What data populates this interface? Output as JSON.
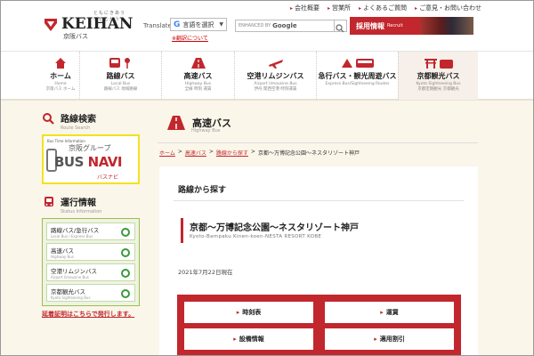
{
  "header": {
    "logo": {
      "tagline": "ともにきあう ひとむかう",
      "brand": "KEIHAN",
      "sub": "京阪バス"
    },
    "top_links": [
      "会社概要",
      "営業所",
      "よくあるご質問",
      "ご意見・お問い合わせ"
    ],
    "translate": {
      "label": "Translate",
      "select_value": "言語を選択",
      "note": "※翻訳について"
    },
    "search": {
      "placeholder_small": "ENHANCED BY",
      "placeholder_brand": "Google"
    },
    "recruit": {
      "label": "採用情報",
      "sub": "Recruit"
    }
  },
  "nav": [
    {
      "label": "ホーム",
      "sub": "Home\n京阪バス ホーム"
    },
    {
      "label": "路線バス",
      "sub": "Local Bus\n路線バス 地域路線"
    },
    {
      "label": "高速バス",
      "sub": "Highway Bus\n全線 時刻 運賃"
    },
    {
      "label": "空港リムジンバス",
      "sub": "Airport limousine Bus\n伊丹 関西空港 時刻運賃"
    },
    {
      "label": "急行バス・観光周遊バス",
      "sub": "Express Bus/Sightseeing Routes"
    },
    {
      "label": "京都観光バス",
      "sub": "Kyoto Sightseeing Bus\n京都定期観光 京都観光"
    }
  ],
  "sidebar": {
    "route_search": {
      "title": "路線検索",
      "sub": "Route Search"
    },
    "busnavi": {
      "small": "Bus Time Information",
      "group": "京阪グループ",
      "bus": "BUS",
      "navi": "NAVI",
      "kana": "バスナビ"
    },
    "status": {
      "title": "運行情報",
      "sub": "Status Information",
      "items": [
        {
          "label": "路線バス/急行バス",
          "sub": "Local Bus / Express Bus"
        },
        {
          "label": "高速バス",
          "sub": "Highway Bus"
        },
        {
          "label": "空港リムジンバス",
          "sub": "Airport limousine Bus"
        },
        {
          "label": "京都観光バス",
          "sub": "Kyoto Sightseeing Bus"
        }
      ]
    },
    "delay_link": "延着証明はこちらで発行します。"
  },
  "main": {
    "title": "高速バス",
    "title_en": "Highway Bus",
    "breadcrumb": [
      "ホーム",
      "高速バス",
      "路線から探す",
      "京都〜万博記念公園〜ネスタリゾート神戸"
    ],
    "panel_heading": "路線から探す",
    "route_jp": "京都〜万博記念公園〜ネスタリゾート神戸",
    "route_en": "Kyoto-Bampaku Kinen-koen-NESTA RESORT KOBE",
    "date": "2021年7月22日現在",
    "buttons": [
      "時刻表",
      "運賃",
      "設備情報",
      "適用割引"
    ]
  },
  "colors": {
    "accent": "#c1272d",
    "status_ok": "#3a9a3a",
    "sidebar_bg": "#fbf6ea"
  }
}
